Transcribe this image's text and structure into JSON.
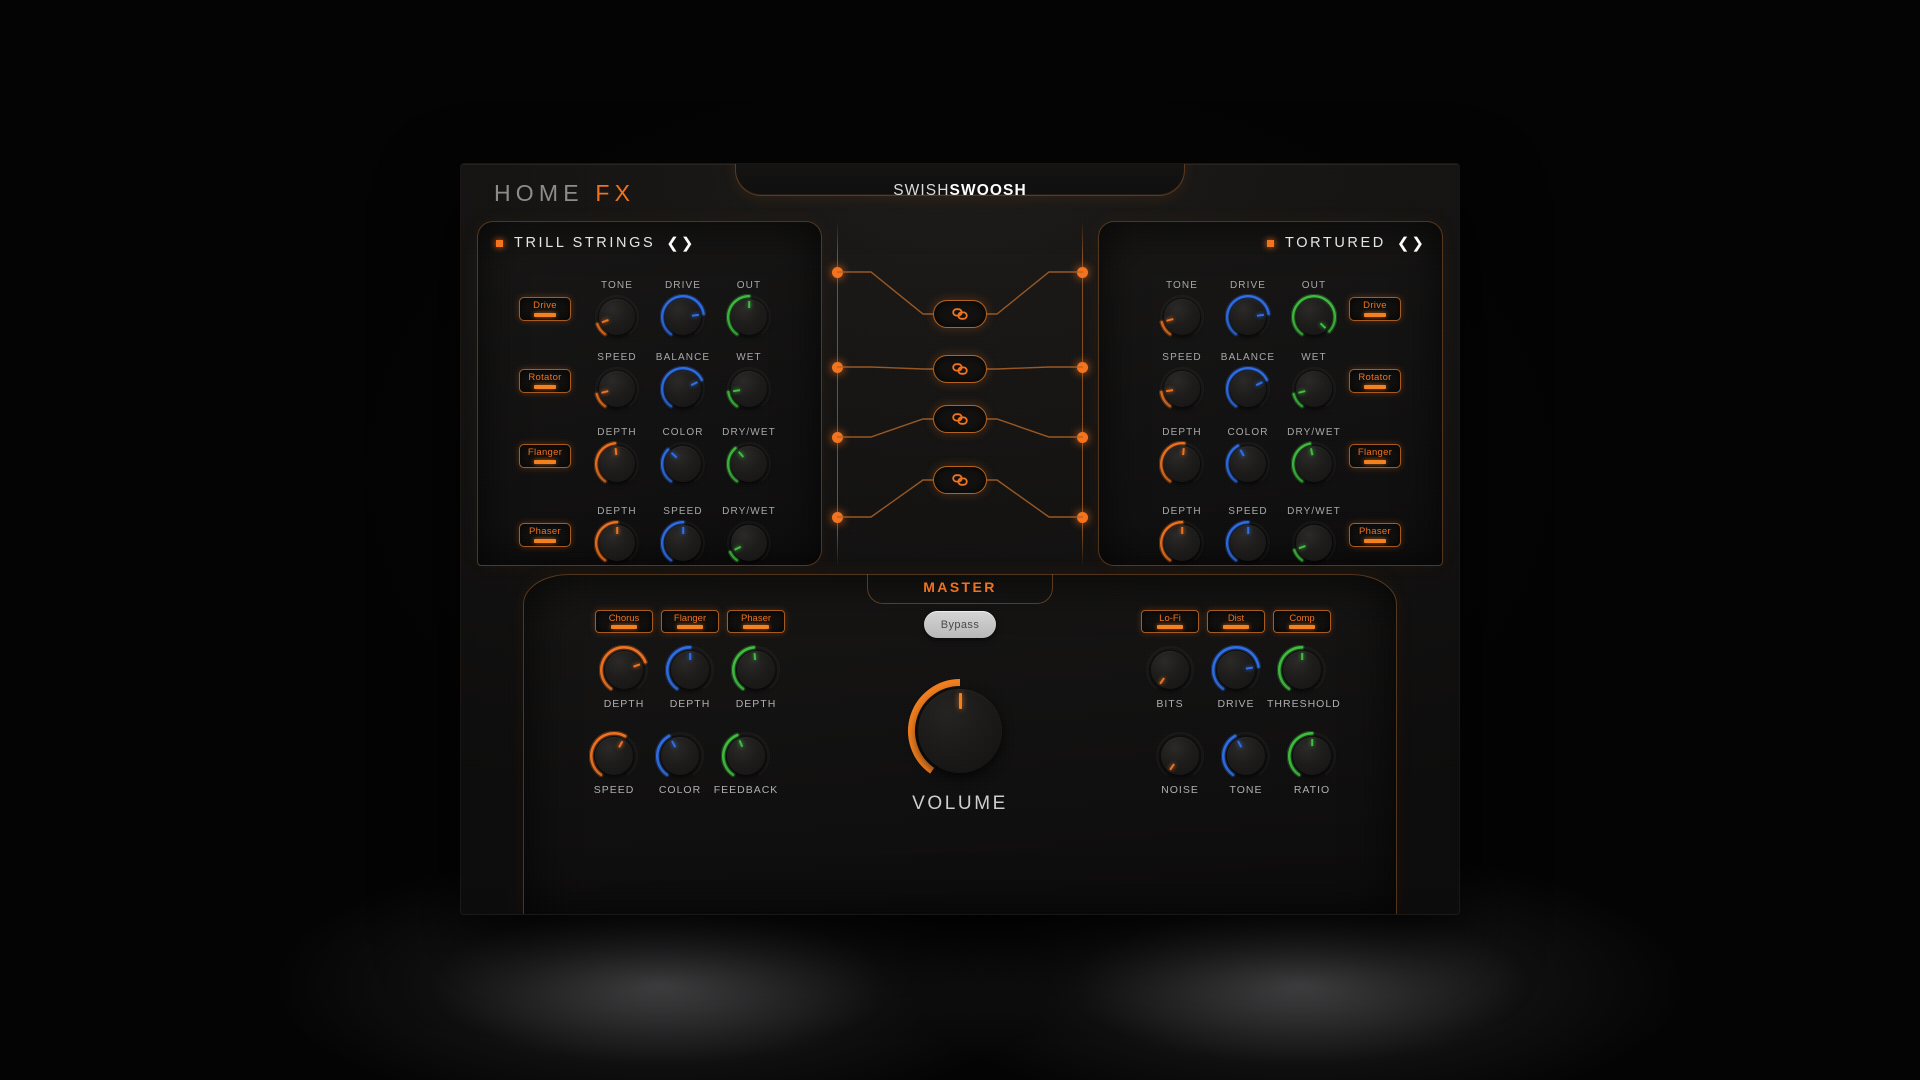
{
  "brand": {
    "word1": "HOME",
    "word2": "FX"
  },
  "title": {
    "light": "SWISH",
    "bold": "SWOOSH"
  },
  "arrows": {
    "prev": "❮",
    "next": "❯"
  },
  "panels": [
    {
      "id": "left",
      "preset_name": "TRILL STRINGS",
      "modules": [
        {
          "button": "Drive",
          "knobs": [
            {
              "cap": "TONE",
              "color": "#f0731f",
              "value": 12
            },
            {
              "cap": "DRIVE",
              "color": "#2f6fe8",
              "value": 78
            },
            {
              "cap": "OUT",
              "color": "#3fbf3f",
              "value": 50
            }
          ]
        },
        {
          "button": "Rotator",
          "knobs": [
            {
              "cap": "SPEED",
              "color": "#f0731f",
              "value": 14
            },
            {
              "cap": "BALANCE",
              "color": "#2f6fe8",
              "value": 72
            },
            {
              "cap": "WET",
              "color": "#3fbf3f",
              "value": 16
            }
          ]
        },
        {
          "button": "Flanger",
          "knobs": [
            {
              "cap": "DEPTH",
              "color": "#f0731f",
              "value": 48
            },
            {
              "cap": "COLOR",
              "color": "#2f6fe8",
              "value": 34
            },
            {
              "cap": "DRY/WET",
              "color": "#3fbf3f",
              "value": 36
            }
          ]
        },
        {
          "button": "Phaser",
          "knobs": [
            {
              "cap": "DEPTH",
              "color": "#f0731f",
              "value": 50
            },
            {
              "cap": "SPEED",
              "color": "#2f6fe8",
              "value": 50
            },
            {
              "cap": "DRY/WET",
              "color": "#3fbf3f",
              "value": 10
            }
          ]
        }
      ]
    },
    {
      "id": "right",
      "preset_name": "TORTURED",
      "modules": [
        {
          "button": "Drive",
          "knobs": [
            {
              "cap": "TONE",
              "color": "#f0731f",
              "value": 14
            },
            {
              "cap": "DRIVE",
              "color": "#2f6fe8",
              "value": 78
            },
            {
              "cap": "OUT",
              "color": "#3fbf3f",
              "value": 96
            }
          ]
        },
        {
          "button": "Rotator",
          "knobs": [
            {
              "cap": "SPEED",
              "color": "#f0731f",
              "value": 16
            },
            {
              "cap": "BALANCE",
              "color": "#2f6fe8",
              "value": 72
            },
            {
              "cap": "WET",
              "color": "#3fbf3f",
              "value": 14
            }
          ]
        },
        {
          "button": "Flanger",
          "knobs": [
            {
              "cap": "DEPTH",
              "color": "#f0731f",
              "value": 52
            },
            {
              "cap": "COLOR",
              "color": "#2f6fe8",
              "value": 40
            },
            {
              "cap": "DRY/WET",
              "color": "#3fbf3f",
              "value": 46
            }
          ]
        },
        {
          "button": "Phaser",
          "knobs": [
            {
              "cap": "DEPTH",
              "color": "#f0731f",
              "value": 50
            },
            {
              "cap": "SPEED",
              "color": "#2f6fe8",
              "value": 50
            },
            {
              "cap": "DRY/WET",
              "color": "#3fbf3f",
              "value": 12
            }
          ]
        }
      ]
    }
  ],
  "links": {
    "icon_name": "link-chain-icon",
    "count": 4
  },
  "master": {
    "title": "MASTER",
    "bypass_label": "Bypass",
    "left_buttons": [
      "Chorus",
      "Flanger",
      "Phaser"
    ],
    "right_buttons": [
      "Lo-Fi",
      "Dist",
      "Comp"
    ],
    "left_knobs_top": [
      {
        "cap": "DEPTH",
        "color": "#f0731f",
        "value": 74
      },
      {
        "cap": "DEPTH",
        "color": "#2f6fe8",
        "value": 50
      },
      {
        "cap": "DEPTH",
        "color": "#3fbf3f",
        "value": 48
      }
    ],
    "left_knobs_bottom": [
      {
        "cap": "SPEED",
        "color": "#f0731f",
        "value": 60
      },
      {
        "cap": "COLOR",
        "color": "#2f6fe8",
        "value": 40
      },
      {
        "cap": "FEEDBACK",
        "color": "#3fbf3f",
        "value": 42
      }
    ],
    "right_knobs_top": [
      {
        "cap": "BITS",
        "color": "#f0731f",
        "value": 0
      },
      {
        "cap": "DRIVE",
        "color": "#2f6fe8",
        "value": 78
      },
      {
        "cap": "THRESHOLD",
        "color": "#3fbf3f",
        "value": 50
      }
    ],
    "right_knobs_bottom": [
      {
        "cap": "NOISE",
        "color": "#f0731f",
        "value": 0
      },
      {
        "cap": "TONE",
        "color": "#2f6fe8",
        "value": 40
      },
      {
        "cap": "RATIO",
        "color": "#3fbf3f",
        "value": 50
      }
    ],
    "volume": {
      "cap": "VOLUME",
      "color": "#f5811f",
      "value": 50
    }
  },
  "colors": {
    "accent": "#f0731f",
    "blue": "#2f6fe8",
    "green": "#3fbf3f",
    "panel_border": "#945c2c",
    "text": "#e7e7e7"
  }
}
